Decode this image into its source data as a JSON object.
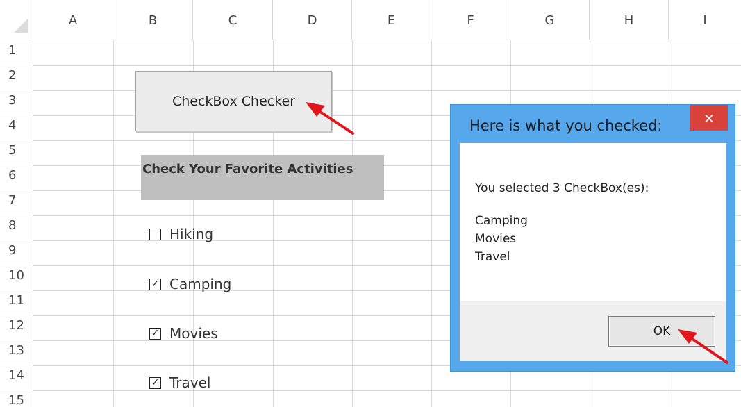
{
  "columns": [
    "A",
    "B",
    "C",
    "D",
    "E",
    "F",
    "G",
    "H",
    "I"
  ],
  "rows": [
    "1",
    "2",
    "3",
    "4",
    "5",
    "6",
    "7",
    "8",
    "9",
    "10",
    "11",
    "12",
    "13",
    "14",
    "15"
  ],
  "checker_button": {
    "label": "CheckBox Checker"
  },
  "activities_label": "Check Your Favorite Activities",
  "checkboxes": [
    {
      "label": "Hiking",
      "checked": false,
      "mark": ""
    },
    {
      "label": "Camping",
      "checked": true,
      "mark": "✓"
    },
    {
      "label": "Movies",
      "checked": true,
      "mark": "✓"
    },
    {
      "label": "Travel",
      "checked": true,
      "mark": "✓"
    }
  ],
  "message_box": {
    "title": "Here is what you checked:",
    "close_glyph": "×",
    "text": "You selected 3 CheckBox(es):",
    "items": [
      "Camping",
      "Movies",
      "Travel"
    ],
    "ok_label": "OK"
  },
  "colors": {
    "dialog_frame": "#57a7ec",
    "close_button": "#d9423a",
    "annotation_arrow": "#e0161c",
    "label_fill": "#bfbfbf"
  }
}
